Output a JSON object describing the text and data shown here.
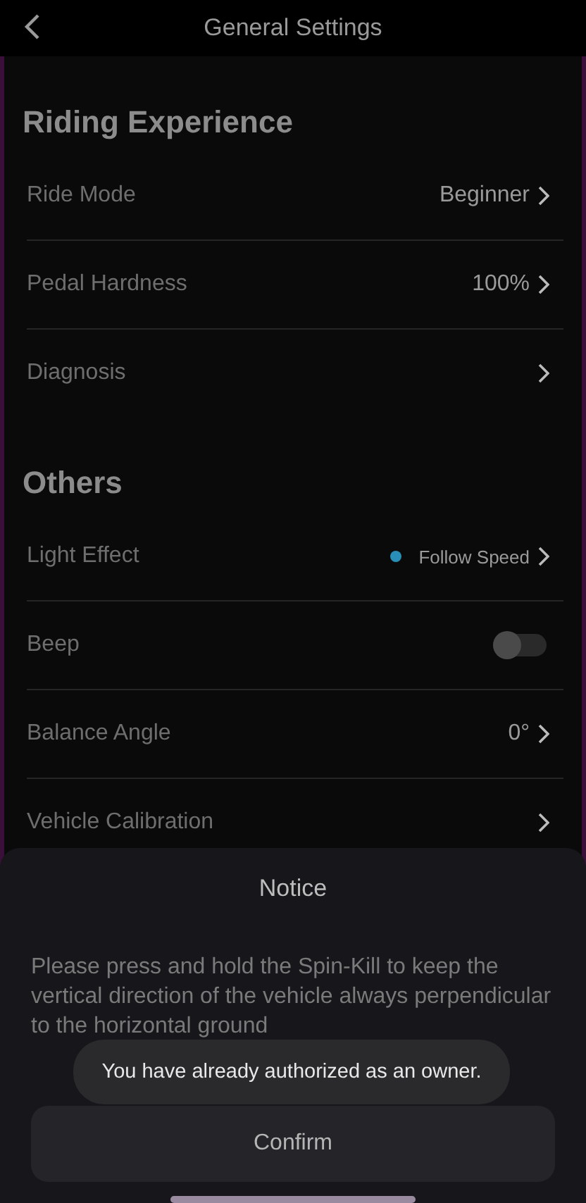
{
  "header": {
    "title": "General Settings"
  },
  "sections": [
    {
      "title": "Riding Experience",
      "rows": [
        {
          "kind": "value",
          "label": "Ride Mode",
          "value": "Beginner"
        },
        {
          "kind": "value",
          "label": "Pedal Hardness",
          "value": "100%"
        },
        {
          "kind": "value",
          "label": "Diagnosis"
        }
      ]
    },
    {
      "title": "Others",
      "rows": [
        {
          "kind": "dot-value",
          "label": "Light Effect",
          "value": "Follow Speed",
          "color": "#2a8fb8"
        },
        {
          "kind": "toggle",
          "label": "Beep",
          "on": false
        },
        {
          "kind": "value",
          "label": "Balance Angle",
          "value": "0°"
        },
        {
          "kind": "value",
          "label": "Vehicle Calibration"
        }
      ]
    }
  ],
  "sheet": {
    "title": "Notice",
    "message": "Please press and hold the Spin-Kill to keep the vertical direction of the vehicle always perpendicular to the horizontal ground",
    "button": "Confirm"
  },
  "toast": {
    "message": "You have already authorized as an owner."
  }
}
